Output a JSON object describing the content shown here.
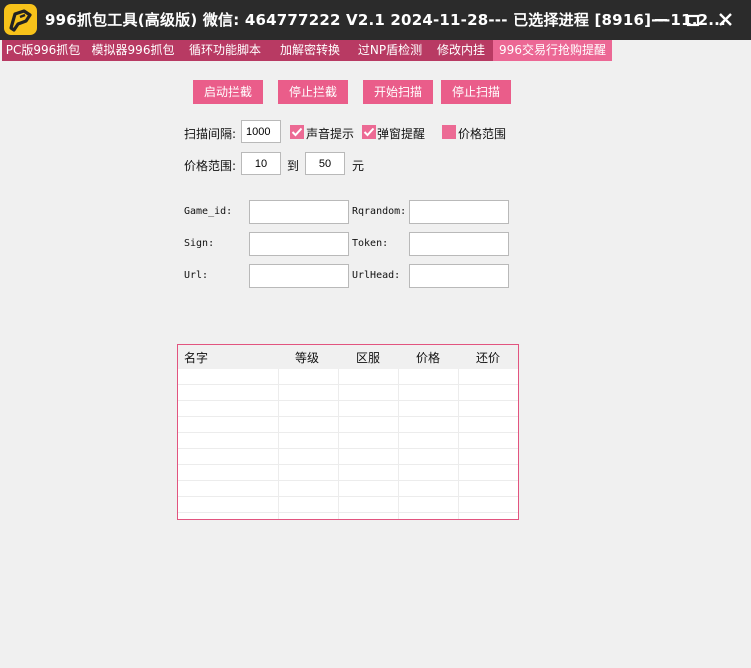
{
  "window": {
    "title": "996抓包工具(高级版)  微信: 464777222   V2.1   2024-11-28--- 已选择进程 [8916]---11.2..."
  },
  "tabs": [
    {
      "label": "PC版996抓包"
    },
    {
      "label": "模拟器996抓包"
    },
    {
      "label": "循环功能脚本"
    },
    {
      "label": "加解密转换"
    },
    {
      "label": "过NP盾检测"
    },
    {
      "label": "修改内挂"
    },
    {
      "label": "996交易行抢购提醒"
    }
  ],
  "buttons": {
    "start_intercept": "启动拦截",
    "stop_intercept": "停止拦截",
    "start_scan": "开始扫描",
    "stop_scan": "停止扫描"
  },
  "scan": {
    "interval_label": "扫描间隔:",
    "interval_value": "1000",
    "sound_label": "声音提示",
    "popup_label": "弹窗提醒",
    "price_range_check_label": "价格范围",
    "price_label": "价格范围:",
    "price_min": "10",
    "to_label": "到",
    "price_max": "50",
    "unit_label": "元"
  },
  "fields": {
    "game_id_label": "Game_id:",
    "rqrandom_label": "Rqrandom:",
    "sign_label": "Sign:",
    "token_label": "Token:",
    "url_label": "Url:",
    "urlhead_label": "UrlHead:"
  },
  "table": {
    "columns": [
      "名字",
      "等级",
      "区服",
      "价格",
      "还价"
    ]
  },
  "colors": {
    "accent": "#ea5d8a",
    "tabbar": "#b83a63",
    "titlebar": "#2b2b2b"
  }
}
